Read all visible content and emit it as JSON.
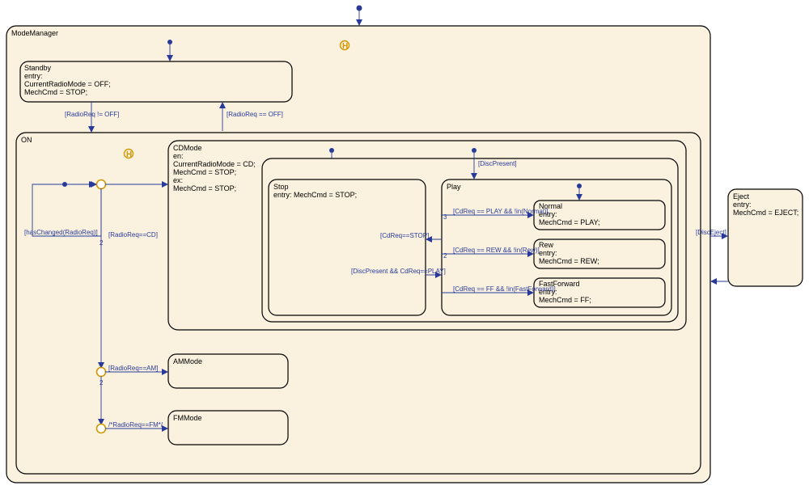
{
  "modeManager": {
    "title": "ModeManager",
    "standby": {
      "title": "Standby",
      "entryLabel": "entry:",
      "line1": "CurrentRadioMode = OFF;",
      "line2": "MechCmd = STOP;"
    },
    "on": {
      "title": "ON",
      "cdMode": {
        "title": "CDMode",
        "enLabel": "en:",
        "en1": "CurrentRadioMode = CD;",
        "en2": "MechCmd = STOP;",
        "exLabel": "ex:",
        "ex1": "MechCmd = STOP;",
        "stop": {
          "title": "Stop",
          "body": "entry: MechCmd = STOP;"
        },
        "play": {
          "title": "Play",
          "normal": {
            "title": "Normal",
            "entryLabel": "entry:",
            "body": "MechCmd = PLAY;"
          },
          "rew": {
            "title": "Rew",
            "entryLabel": "entry:",
            "body": "MechCmd = REW;"
          },
          "ff": {
            "title": "FastForward",
            "entryLabel": "entry:",
            "body": "MechCmd = FF;"
          }
        }
      },
      "amMode": {
        "title": "AMMode"
      },
      "fmMode": {
        "title": "FMMode"
      }
    }
  },
  "eject": {
    "title": "Eject",
    "entryLabel": "entry:",
    "body": "MechCmd = EJECT;"
  },
  "transitions": {
    "radioReqNotOff": "[RadioReq != OFF]",
    "radioReqOff": "[RadioReq == OFF]",
    "hasChanged": "[hasChanged(RadioReq)]",
    "radioReqCD": "[RadioReq==CD]",
    "radioReqAM": "[RadioReq==AM]",
    "radioReqFM": "/*RadioReq==FM*/",
    "discPresent": "[DiscPresent]",
    "cdReqStop": "[CdReq==STOP]",
    "discPresentPlay": "[DiscPresent && CdReq==PLAY]",
    "cdReqPlayNotNormal": "[CdReq == PLAY && !in(Normal)]",
    "cdReqRewNotRew": "[CdReq == REW && !in(Rew)]",
    "cdReqFFNotFF": "[CdReq == FF && !in(FastForward)]",
    "discEject": "[DiscEject]"
  },
  "priorities": {
    "p2a": "2",
    "p2b": "2",
    "p3": "3",
    "p2c": "2"
  }
}
